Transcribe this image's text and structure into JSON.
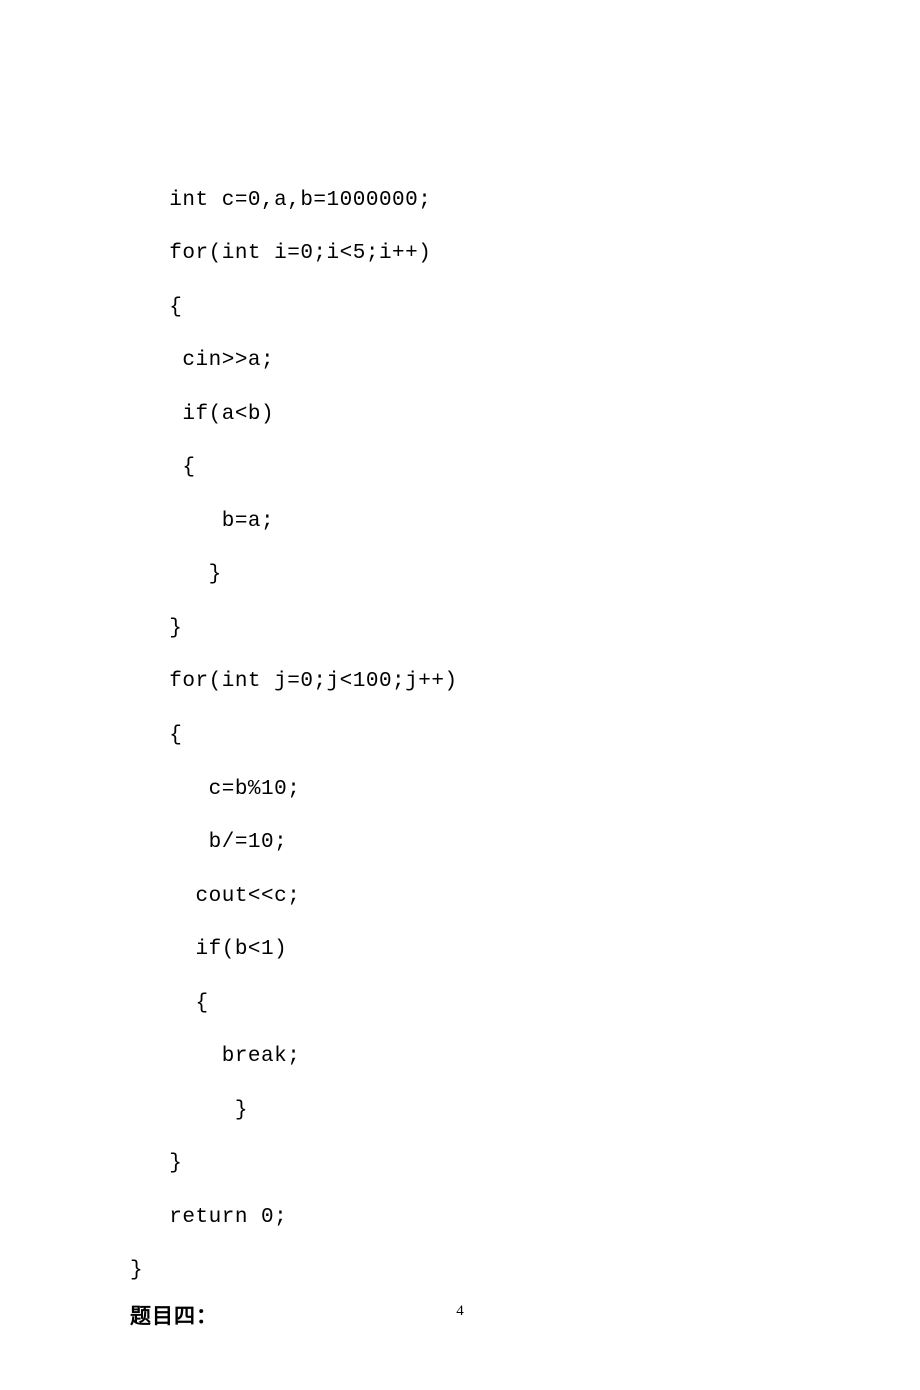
{
  "code": {
    "line01": "   int c=0,a,b=1000000;",
    "line02": "   for(int i=0;i<5;i++)",
    "line03": "   {",
    "line04": "    cin>>a;",
    "line05": "    if(a<b)",
    "line06": "    {",
    "line07": "       b=a;",
    "line08": "      }",
    "line09": "   }",
    "line10": "   for(int j=0;j<100;j++)",
    "line11": "   {",
    "line12": "      c=b%10;",
    "line13": "      b/=10;",
    "line14": "     cout<<c;",
    "line15": "     if(b<1)",
    "line16": "     {",
    "line17": "       break;",
    "line18": "        }",
    "line19": "   }",
    "line20": "   return 0;",
    "line21": "}"
  },
  "heading": "题目四：",
  "page_number": "4"
}
